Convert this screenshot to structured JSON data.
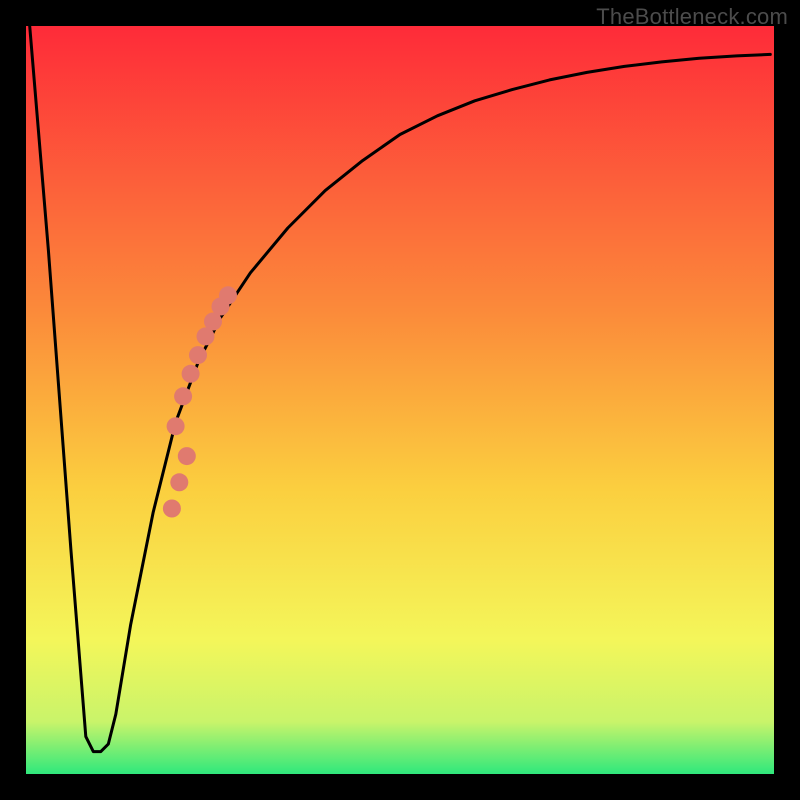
{
  "watermark": "TheBottleneck.com",
  "chart_data": {
    "type": "line",
    "title": "",
    "xlabel": "",
    "ylabel": "",
    "xlim": [
      0,
      100
    ],
    "ylim": [
      0,
      100
    ],
    "grid": false,
    "legend": false,
    "background_gradient": {
      "top_color": "#fe2b39",
      "mid_color": "#f9e748",
      "bottom_color": "#2fe87c"
    },
    "series": [
      {
        "name": "bottleneck-curve",
        "type": "line",
        "color": "#000000",
        "x": [
          0.5,
          3,
          6,
          8,
          9,
          10,
          11,
          12,
          14,
          17,
          20,
          23,
          26,
          30,
          35,
          40,
          45,
          50,
          55,
          60,
          65,
          70,
          75,
          80,
          85,
          90,
          95,
          99.5
        ],
        "values": [
          100,
          70,
          30,
          5,
          3,
          3,
          4,
          8,
          20,
          35,
          47,
          55,
          61,
          67,
          73,
          78,
          82,
          85.5,
          88,
          90,
          91.5,
          92.8,
          93.8,
          94.6,
          95.2,
          95.7,
          96.0,
          96.2
        ]
      },
      {
        "name": "highlight-markers",
        "type": "scatter",
        "color": "#e07a6f",
        "x": [
          20,
          21,
          22,
          23,
          24,
          25,
          26,
          27,
          21.5,
          20.5,
          19.5
        ],
        "values": [
          46.5,
          50.5,
          53.5,
          56.0,
          58.5,
          60.5,
          62.5,
          64.0,
          42.5,
          39.0,
          35.5
        ],
        "marker_radius": 9
      }
    ]
  }
}
